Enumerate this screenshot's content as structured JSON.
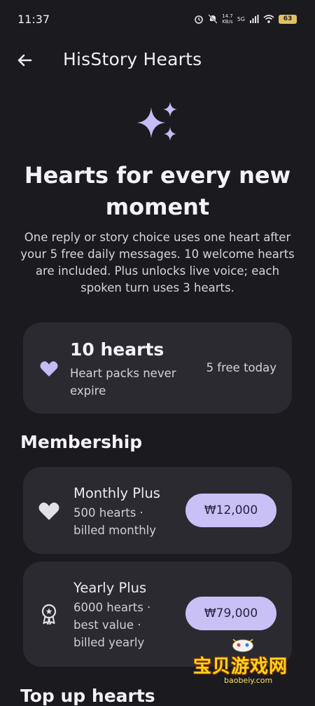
{
  "status_bar": {
    "time": "11:37",
    "net_speed_value": "14.7",
    "net_speed_unit": "KB/s",
    "network": "5G",
    "battery": "63",
    "icons": [
      "alarm-icon",
      "mute-icon",
      "signal-icon",
      "wifi-icon",
      "battery-icon"
    ]
  },
  "app_bar": {
    "title": "HisStory Hearts"
  },
  "hero": {
    "title": "Hearts for every new moment",
    "description": "One reply or story choice uses one heart after your 5 free daily messages. 10 welcome hearts are included. Plus unlocks live voice; each spoken turn uses 3 hearts."
  },
  "balance": {
    "count": "10 hearts",
    "note": "Heart packs never expire",
    "free_today": "5 free today"
  },
  "membership": {
    "title": "Membership",
    "plans": [
      {
        "name": "Monthly Plus",
        "detail": "500 hearts · billed monthly",
        "price": "₩12,000",
        "icon": "heart-icon"
      },
      {
        "name": "Yearly Plus",
        "detail": "6000 hearts · best value · billed yearly",
        "price": "₩79,000",
        "icon": "award-icon"
      }
    ]
  },
  "topup": {
    "title": "Top up hearts"
  },
  "watermark": {
    "text": "宝贝游戏网",
    "url": "baobeiy.com"
  },
  "colors": {
    "background": "#1b1a1f",
    "card": "#2b2a30",
    "accent": "#c9c0f6",
    "sparkle": "#c4bcf5"
  }
}
